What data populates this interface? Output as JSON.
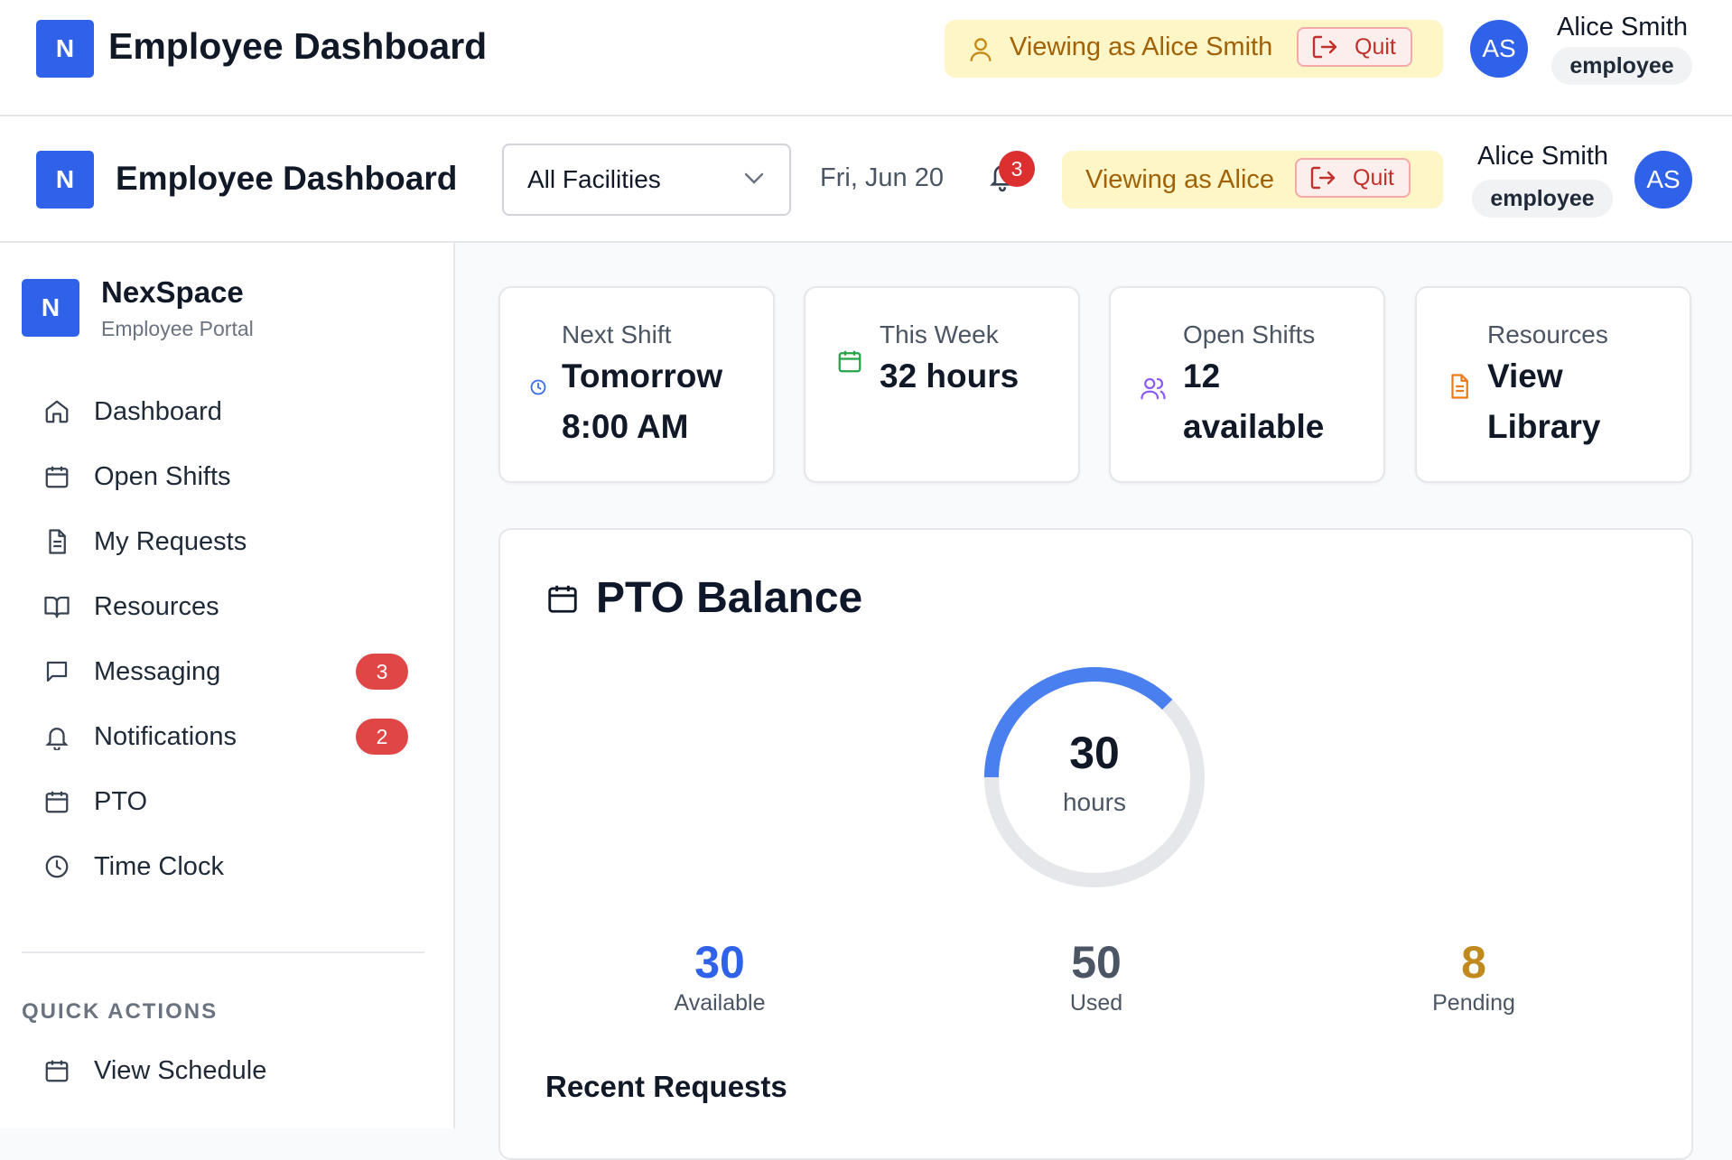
{
  "header_primary": {
    "logo_letter": "N",
    "title": "Employee Dashboard",
    "viewing_text": "Viewing as Alice Smith",
    "quit_label": "Quit",
    "avatar_initials": "AS",
    "user_name": "Alice Smith",
    "user_role": "employee"
  },
  "header_secondary": {
    "logo_letter": "N",
    "title": "Employee Dashboard",
    "facility_select": "All Facilities",
    "date": "Fri, Jun 20",
    "notification_count": "3",
    "viewing_text": "Viewing as Alice",
    "quit_label": "Quit",
    "user_name": "Alice Smith",
    "user_role": "employee",
    "avatar_initials": "AS"
  },
  "sidebar": {
    "logo_letter": "N",
    "brand": "NexSpace",
    "subtitle": "Employee Portal",
    "items": [
      {
        "label": "Dashboard",
        "icon": "home-icon"
      },
      {
        "label": "Open Shifts",
        "icon": "calendar-icon"
      },
      {
        "label": "My Requests",
        "icon": "document-icon"
      },
      {
        "label": "Resources",
        "icon": "book-open-icon"
      },
      {
        "label": "Messaging",
        "icon": "message-icon",
        "badge": "3"
      },
      {
        "label": "Notifications",
        "icon": "bell-icon",
        "badge": "2"
      },
      {
        "label": "PTO",
        "icon": "calendar-icon"
      },
      {
        "label": "Time Clock",
        "icon": "clock-icon"
      }
    ],
    "quick_actions_heading": "QUICK ACTIONS",
    "quick_actions": [
      {
        "label": "View Schedule",
        "icon": "calendar-icon"
      }
    ]
  },
  "cards": [
    {
      "label": "Next Shift",
      "value_line1": "Tomorrow",
      "value_line2": "8:00 AM",
      "icon": "clock-icon",
      "color": "#3b6fe0"
    },
    {
      "label": "This Week",
      "value_line1": "32 hours",
      "value_line2": "",
      "icon": "calendar-icon",
      "color": "#22a447"
    },
    {
      "label": "Open Shifts",
      "value_line1": "12",
      "value_line2": "available",
      "icon": "users-icon",
      "color": "#8b5cf6"
    },
    {
      "label": "Resources",
      "value_line1": "View",
      "value_line2": "Library",
      "icon": "document-icon",
      "color": "#ea7c1e"
    }
  ],
  "pto": {
    "title": "PTO Balance",
    "ring_value": "30",
    "ring_unit": "hours",
    "ring_fraction": 0.375,
    "available_value": "30",
    "available_label": "Available",
    "used_value": "50",
    "used_label": "Used",
    "pending_value": "8",
    "pending_label": "Pending",
    "recent_heading": "Recent Requests"
  },
  "colors": {
    "brand": "#2f62e8",
    "ring_progress": "#4a7ff0",
    "ring_track": "#e5e7eb",
    "available": "#2f62e8",
    "used": "#4b5563",
    "pending": "#c08a1e",
    "badge": "#e04646",
    "viewing_bg": "#fef6c7"
  }
}
